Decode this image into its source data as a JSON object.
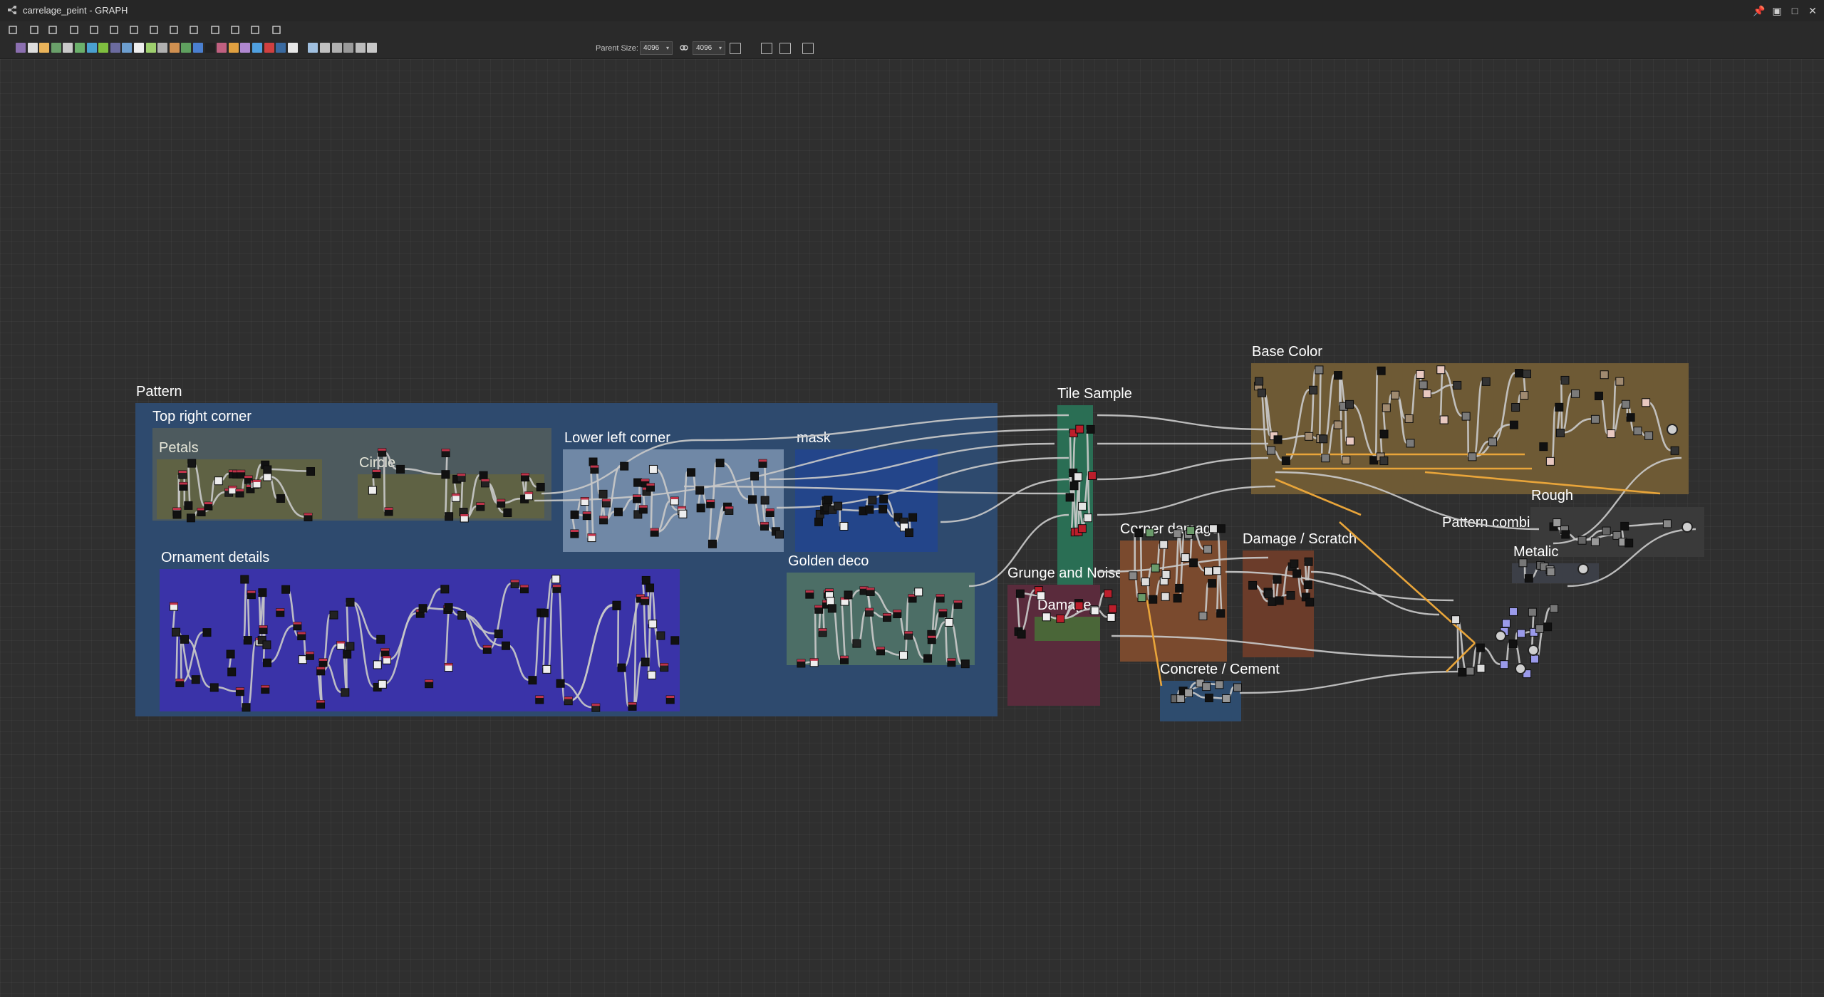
{
  "window": {
    "title": "carrelage_peint - GRAPH",
    "controls": [
      "pin-icon",
      "float-icon",
      "maximize-icon",
      "close-icon"
    ]
  },
  "toolbar": {
    "view_tools": [
      "frame-all-icon",
      "pan-icon",
      "camera-icon",
      "info-icon",
      "search-icon",
      "align-icon",
      "share-icon",
      "layout-icon",
      "link-style-icon",
      "connect-icon",
      "refresh-icon",
      "tools-icon",
      "image-icon",
      "grid-icon"
    ],
    "node_library": [
      "bitmap-icon",
      "svg-icon",
      "text-icon",
      "uniform-color-icon",
      "shuffle-icon",
      "curve-icon",
      "tiles-icon",
      "gradient-icon",
      "blur-icon",
      "blend-icon",
      "levels-icon",
      "normal-icon",
      "warp-icon",
      "fx-map-icon",
      "pixel-processor-icon",
      "noise-icon",
      "pattern-icon",
      "sharpen-icon",
      "histogram-icon",
      "text-node-icon",
      "transform-icon",
      "bake-icon",
      "output-icon",
      "input-icon",
      "frame-node-icon",
      "comment-icon",
      "pin-node-icon",
      "dot-icon",
      "graph-icon",
      "gpu-icon"
    ],
    "parent_size_label": "Parent Size:",
    "parent_size_width": "4096",
    "parent_size_height": "4096",
    "extra_tools": [
      "link-lock-icon",
      "reset-icon",
      "split-icon",
      "node-stack-icon",
      "crop-icon"
    ]
  },
  "frames": {
    "pattern": "Pattern",
    "top_right_corner": "Top right corner",
    "petals": "Petals",
    "circle": "Circle",
    "lower_left_corner": "Lower left corner",
    "mask": "mask",
    "ornament_details": "Ornament details",
    "golden_deco": "Golden deco",
    "tile_sample": "Tile Sample",
    "grunge_and_noise": "Grunge and Noise",
    "damage": "Damage",
    "corner_damage": "Corner damage",
    "damage_scratch": "Damage / Scratch",
    "concrete_cement": "Concrete / Cement",
    "base_color": "Base Color",
    "rough": "Rough",
    "pattern_combine": "Pattern combi",
    "metalic": "Metalic"
  },
  "colors": {
    "canvas": "#2f2f2f",
    "pattern_frame": "#2e4a6e",
    "top_right_frame": "#4a5a60",
    "petals_frame": "#5f6244",
    "circle_frame": "#5f6244",
    "lower_left_frame": "#6f8aa8",
    "mask_frame": "#23458a",
    "ornament_frame": "#3a33a8",
    "golden_frame": "#4c6e66",
    "tile_sample_frame": "#2a6e54",
    "grunge_frame": "#5a2b3c",
    "damage_frame": "#4a6638",
    "corner_damage_frame": "#7a4a2e",
    "damage_scratch_frame": "#6b3c2a",
    "concrete_frame": "#2e4c6e",
    "base_color_frame": "#6e5a35",
    "rough_frame": "#3a3a3a",
    "metalic_frame": "#3c3f47",
    "link_default": "#c8c8c8",
    "link_selected": "#e9a53a"
  }
}
